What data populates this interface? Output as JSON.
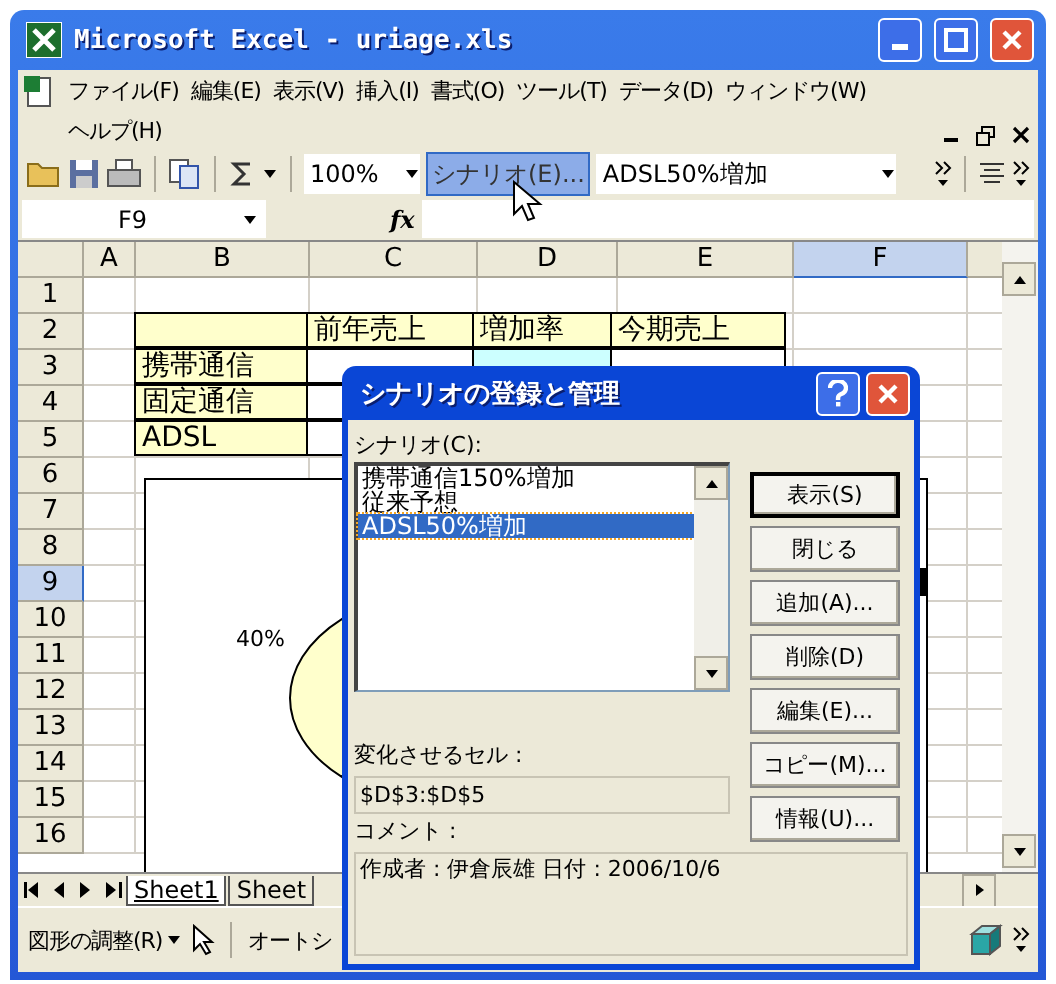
{
  "window": {
    "title": "Microsoft Excel - uriage.xls"
  },
  "menu": [
    "ファイル(F)",
    "編集(E)",
    "表示(V)",
    "挿入(I)",
    "書式(O)",
    "ツール(T)",
    "データ(D)",
    "ウィンドウ(W)",
    "ヘルプ(H)"
  ],
  "toolbar": {
    "zoom": "100%",
    "scenario_button": {
      "label": "シナリオ(E)...",
      "highlighted": true
    },
    "scenario_select": "ADSL50%増加"
  },
  "formula_bar": {
    "name_box": "F9",
    "function_label": "fx"
  },
  "sheet": {
    "columns": [
      {
        "label": "A",
        "selected": false
      },
      {
        "label": "B",
        "selected": false
      },
      {
        "label": "C",
        "selected": false
      },
      {
        "label": "D",
        "selected": false
      },
      {
        "label": "E",
        "selected": false
      },
      {
        "label": "F",
        "selected": true
      }
    ],
    "rows": [
      {
        "label": "1",
        "selected": false,
        "cells": {}
      },
      {
        "label": "2",
        "selected": false,
        "cells": {
          "B": {
            "color": "#ffffcc"
          },
          "C": {
            "text": "前年売上",
            "color": "#ffffcc"
          },
          "D": {
            "text": "増加率",
            "color": "#ffffcc"
          },
          "E": {
            "text": "今期売上",
            "color": "#ffffcc"
          }
        }
      },
      {
        "label": "3",
        "selected": false,
        "cells": {
          "B": {
            "text": "携帯通信",
            "color": "#ffffcc"
          },
          "C": {
            "color": "#ffffff"
          },
          "D": {
            "color": "#ccffff"
          },
          "E": {
            "color": "#ffffff"
          }
        }
      },
      {
        "label": "4",
        "selected": false,
        "cells": {
          "B": {
            "text": "固定通信",
            "color": "#ffffcc"
          },
          "C": {
            "color": "#ffffff"
          }
        }
      },
      {
        "label": "5",
        "selected": false,
        "cells": {
          "B": {
            "text": "ADSL",
            "color": "#ffffcc"
          },
          "C": {
            "color": "#ffffff"
          }
        }
      },
      {
        "label": "6",
        "selected": false,
        "cells": {}
      },
      {
        "label": "7",
        "selected": false,
        "cells": {}
      },
      {
        "label": "8",
        "selected": false,
        "cells": {}
      },
      {
        "label": "9",
        "selected": true,
        "cells": {}
      },
      {
        "label": "10",
        "selected": false,
        "cells": {}
      },
      {
        "label": "11",
        "selected": false,
        "cells": {}
      },
      {
        "label": "12",
        "selected": false,
        "cells": {}
      },
      {
        "label": "13",
        "selected": false,
        "cells": {}
      },
      {
        "label": "14",
        "selected": false,
        "cells": {}
      },
      {
        "label": "15",
        "selected": false,
        "cells": {}
      },
      {
        "label": "16",
        "selected": false,
        "cells": {}
      }
    ],
    "chart": {
      "data_label": "40%"
    }
  },
  "sheet_tabs": [
    {
      "label": "Sheet1",
      "selected": true
    },
    {
      "label": "Sheet",
      "selected": false
    }
  ],
  "drawing_toolbar": {
    "draw_menu": "図形の調整(R)",
    "autoshapes_menu": "オートシ"
  },
  "dialog": {
    "title": "シナリオの登録と管理",
    "list_label": "シナリオ(C):",
    "scenarios": [
      {
        "label": "携帯通信150%増加",
        "selected": false
      },
      {
        "label": "従来予想",
        "selected": false
      },
      {
        "label": "ADSL50%増加",
        "selected": true
      }
    ],
    "buttons": [
      {
        "label": "表示(S)",
        "default": true
      },
      {
        "label": "閉じる",
        "default": false
      },
      {
        "label": "追加(A)...",
        "default": false
      },
      {
        "label": "削除(D)",
        "default": false
      },
      {
        "label": "編集(E)...",
        "default": false
      },
      {
        "label": "コピー(M)...",
        "default": false
      },
      {
        "label": "情報(U)...",
        "default": false
      }
    ],
    "changing_cells_label": "変化させるセル :",
    "changing_cells": "$D$3:$D$5",
    "comment_label": "コメント :",
    "comment": "作成者 : 伊倉辰雄 日付 : 2006/10/6"
  }
}
